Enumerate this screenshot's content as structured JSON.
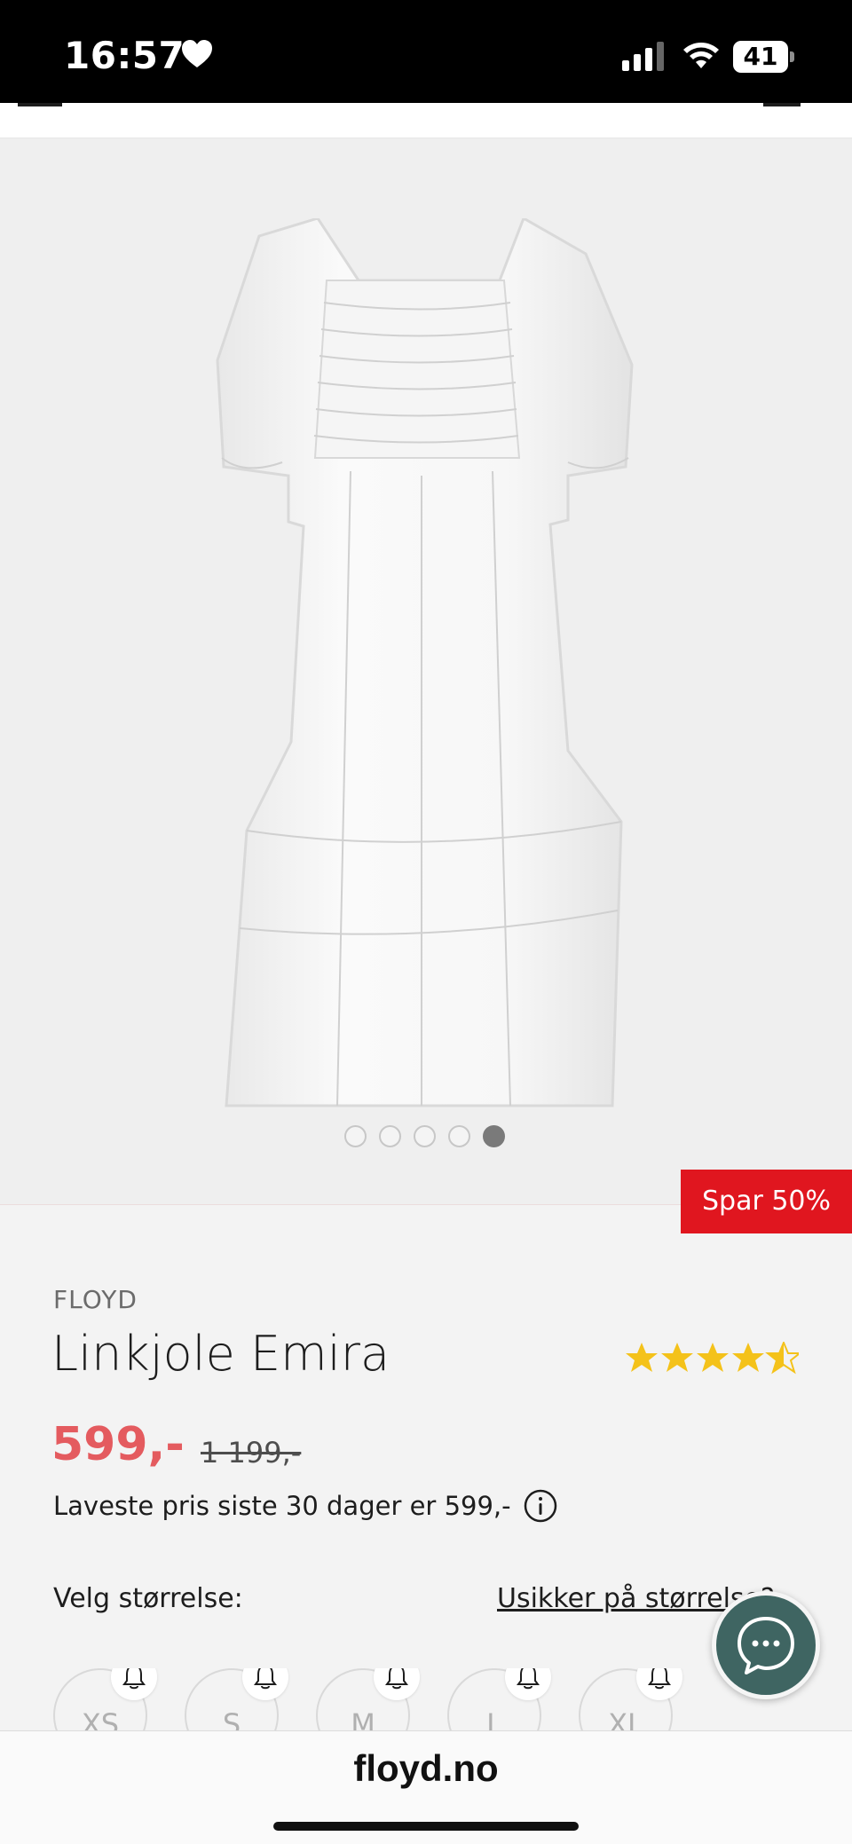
{
  "status_bar": {
    "time": "16:57",
    "battery": "41",
    "icons": [
      "heart-icon",
      "signal-icon",
      "wifi-icon",
      "battery-icon"
    ]
  },
  "gallery": {
    "image": "white linen dress",
    "dots": 5,
    "active_dot": 4,
    "badge": "Spar 50%"
  },
  "product": {
    "brand": "FLOYD",
    "title": "Linkjole Emira",
    "rating": 4.5,
    "price": "599,-",
    "old_price": "1 199,-",
    "lowest_price_text": "Laveste pris siste 30 dager er 599,-",
    "size_label": "Velg størrelse:",
    "size_help": "Usikker på størrelse?"
  },
  "sizes": [
    "XS",
    "S",
    "M",
    "L",
    "XL"
  ],
  "browser": {
    "domain": "floyd.no"
  },
  "colors": {
    "sale": "#e45b5f",
    "badge": "#e0161f",
    "star": "#f4c21a",
    "chat": "#3f6562"
  }
}
